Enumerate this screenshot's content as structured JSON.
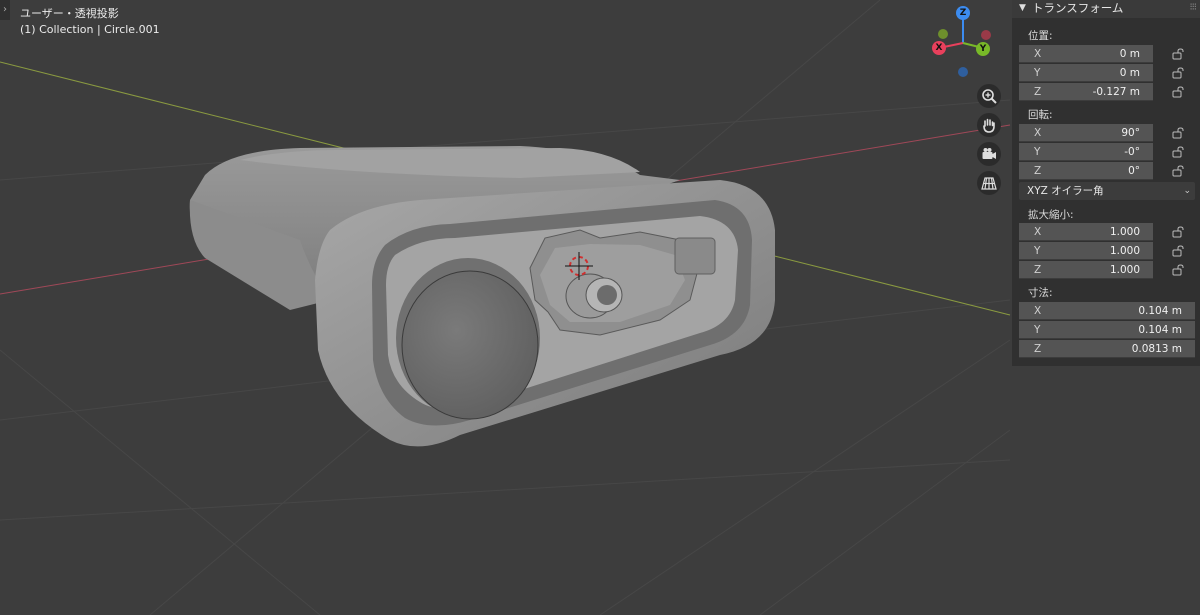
{
  "viewport": {
    "view_title": "ユーザー・透視投影",
    "collection_label": "(1) Collection | Circle.001",
    "background": "#3d3d3d",
    "x_axis_color": "#a04858",
    "y_axis_color": "#8a9a40"
  },
  "gizmo": {
    "x_label": "X",
    "y_label": "Y",
    "z_label": "Z",
    "x_color": "#e8405c",
    "y_color": "#78b928",
    "z_color": "#3c8cf0"
  },
  "nav_buttons": [
    "zoom-icon",
    "pan-hand-icon",
    "camera-icon",
    "grid-ortho-icon"
  ],
  "panel": {
    "title": "トランスフォーム",
    "location": {
      "label": "位置:",
      "x": {
        "axis": "X",
        "value": "0 m"
      },
      "y": {
        "axis": "Y",
        "value": "0 m"
      },
      "z": {
        "axis": "Z",
        "value": "-0.127 m"
      }
    },
    "rotation": {
      "label": "回転:",
      "x": {
        "axis": "X",
        "value": "90°"
      },
      "y": {
        "axis": "Y",
        "value": "-0°"
      },
      "z": {
        "axis": "Z",
        "value": "0°"
      }
    },
    "rotation_mode": "XYZ オイラー角",
    "scale": {
      "label": "拡大縮小:",
      "x": {
        "axis": "X",
        "value": "1.000"
      },
      "y": {
        "axis": "Y",
        "value": "1.000"
      },
      "z": {
        "axis": "Z",
        "value": "1.000"
      }
    },
    "dimensions": {
      "label": "寸法:",
      "x": {
        "axis": "X",
        "value": "0.104 m"
      },
      "y": {
        "axis": "Y",
        "value": "0.104 m"
      },
      "z": {
        "axis": "Z",
        "value": "0.0813 m"
      }
    }
  }
}
